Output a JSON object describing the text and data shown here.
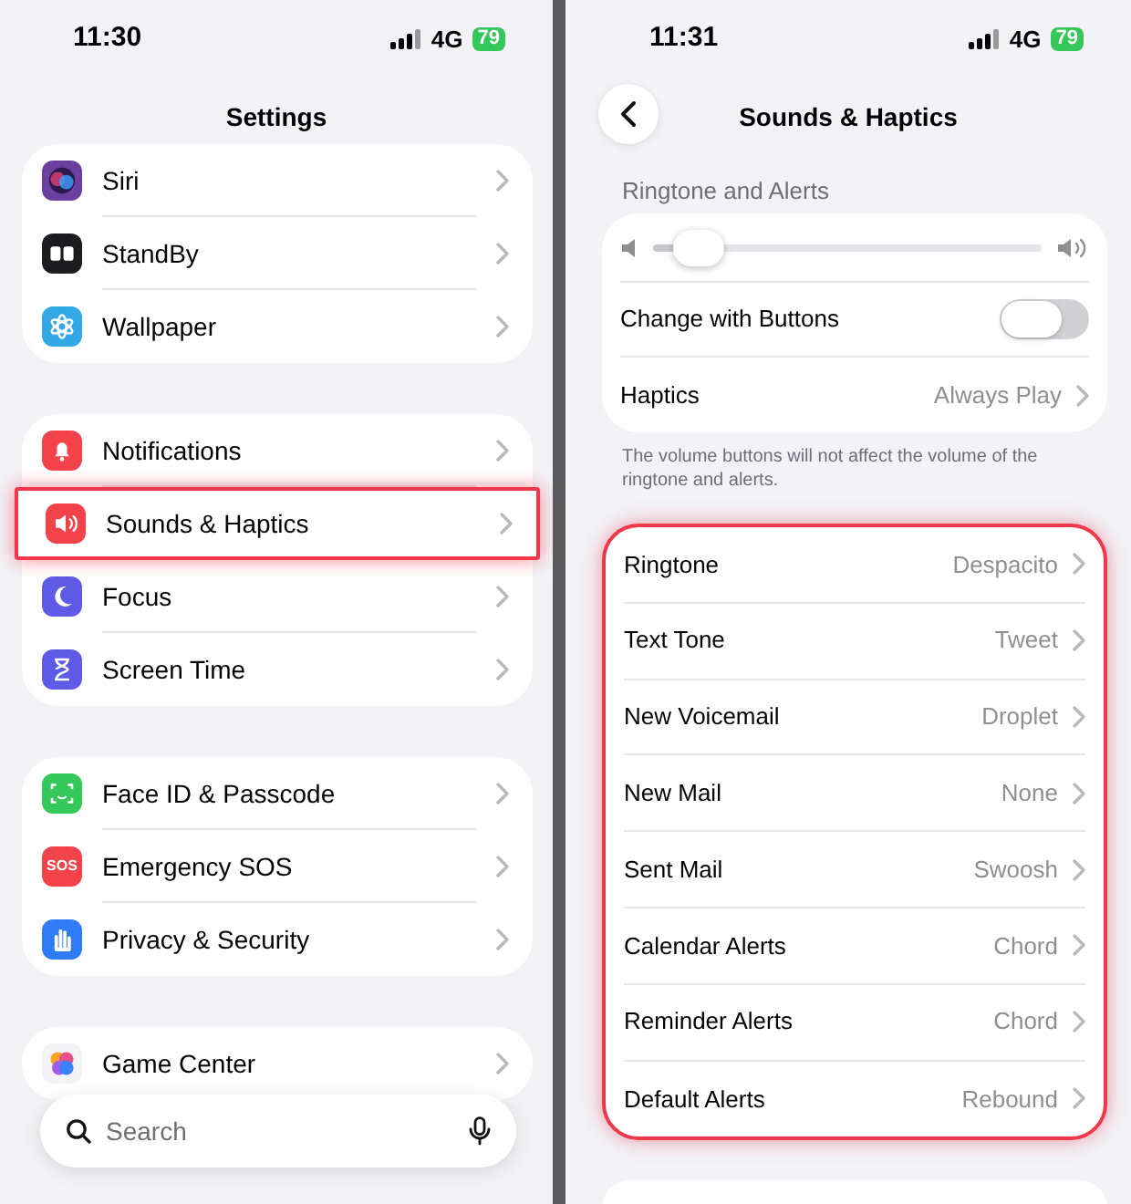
{
  "left": {
    "status_bar": {
      "time": "11:30",
      "network": "4G",
      "battery": "79"
    },
    "title": "Settings",
    "groups": [
      {
        "items": [
          {
            "label": "Siri",
            "color": "#6b3fa0",
            "highlighted": false
          },
          {
            "label": "StandBy",
            "color": "#1c1c1e",
            "highlighted": false
          },
          {
            "label": "Wallpaper",
            "color": "#32a8e6",
            "highlighted": false
          }
        ]
      },
      {
        "items": [
          {
            "label": "Notifications",
            "color": "#f2434a",
            "highlighted": false
          },
          {
            "label": "Sounds & Haptics",
            "color": "#f2434a",
            "highlighted": true
          },
          {
            "label": "Focus",
            "color": "#5e5ce6",
            "highlighted": false
          },
          {
            "label": "Screen Time",
            "color": "#5e5ce6",
            "highlighted": false
          }
        ]
      },
      {
        "items": [
          {
            "label": "Face ID & Passcode",
            "color": "#34c759",
            "highlighted": false
          },
          {
            "label": "Emergency SOS",
            "icon_text": "SOS",
            "color": "#f2434a",
            "highlighted": false
          },
          {
            "label": "Privacy & Security",
            "color": "#2f7cf6",
            "highlighted": false
          }
        ]
      },
      {
        "items": [
          {
            "label": "Game Center",
            "color": "#f4f4f6",
            "highlighted": false
          }
        ]
      }
    ],
    "search": {
      "placeholder": "Search"
    }
  },
  "right": {
    "status_bar": {
      "time": "11:31",
      "network": "4G",
      "battery": "79"
    },
    "title": "Sounds & Haptics",
    "section_header": "Ringtone and Alerts",
    "volume": {
      "level": 0.06
    },
    "change_with_buttons": {
      "label": "Change with Buttons",
      "on": false
    },
    "haptics": {
      "label": "Haptics",
      "value": "Always Play"
    },
    "footer": "The volume buttons will not affect the volume of the ringtone and alerts.",
    "sounds": {
      "highlighted": true,
      "items": [
        {
          "label": "Ringtone",
          "value": "Despacito"
        },
        {
          "label": "Text Tone",
          "value": "Tweet"
        },
        {
          "label": "New Voicemail",
          "value": "Droplet"
        },
        {
          "label": "New Mail",
          "value": "None"
        },
        {
          "label": "Sent Mail",
          "value": "Swoosh"
        },
        {
          "label": "Calendar Alerts",
          "value": "Chord"
        },
        {
          "label": "Reminder Alerts",
          "value": "Chord"
        },
        {
          "label": "Default Alerts",
          "value": "Rebound"
        }
      ]
    }
  }
}
